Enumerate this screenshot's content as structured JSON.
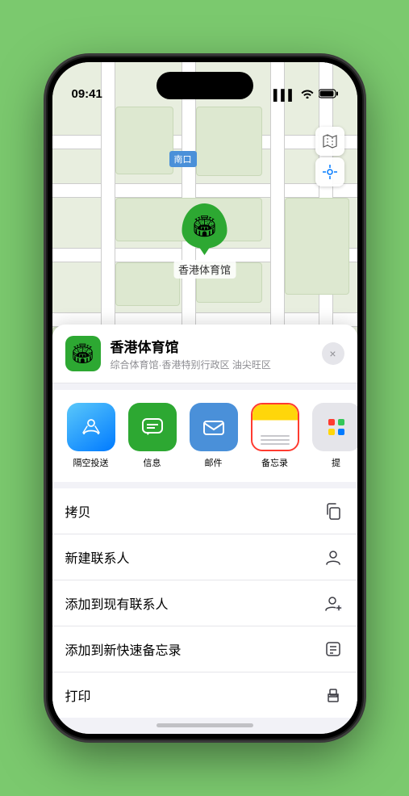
{
  "status_bar": {
    "time": "09:41",
    "signal": "▌▌▌",
    "wifi": "WiFi",
    "battery": "Battery"
  },
  "map": {
    "label_south": "南口",
    "stadium_label": "香港体育馆"
  },
  "location_card": {
    "name": "香港体育馆",
    "subtitle": "综合体育馆·香港特别行政区 油尖旺区",
    "close_label": "×"
  },
  "share_actions": [
    {
      "id": "airdrop",
      "label": "隔空投送",
      "type": "airdrop"
    },
    {
      "id": "message",
      "label": "信息",
      "type": "message"
    },
    {
      "id": "mail",
      "label": "邮件",
      "type": "mail"
    },
    {
      "id": "notes",
      "label": "备忘录",
      "type": "notes"
    },
    {
      "id": "more",
      "label": "提",
      "type": "more"
    }
  ],
  "actions": [
    {
      "id": "copy",
      "label": "拷贝",
      "icon": "copy"
    },
    {
      "id": "new-contact",
      "label": "新建联系人",
      "icon": "person"
    },
    {
      "id": "add-existing",
      "label": "添加到现有联系人",
      "icon": "person-add"
    },
    {
      "id": "add-notes",
      "label": "添加到新快速备忘录",
      "icon": "notes-badge"
    },
    {
      "id": "print",
      "label": "打印",
      "icon": "print"
    }
  ]
}
